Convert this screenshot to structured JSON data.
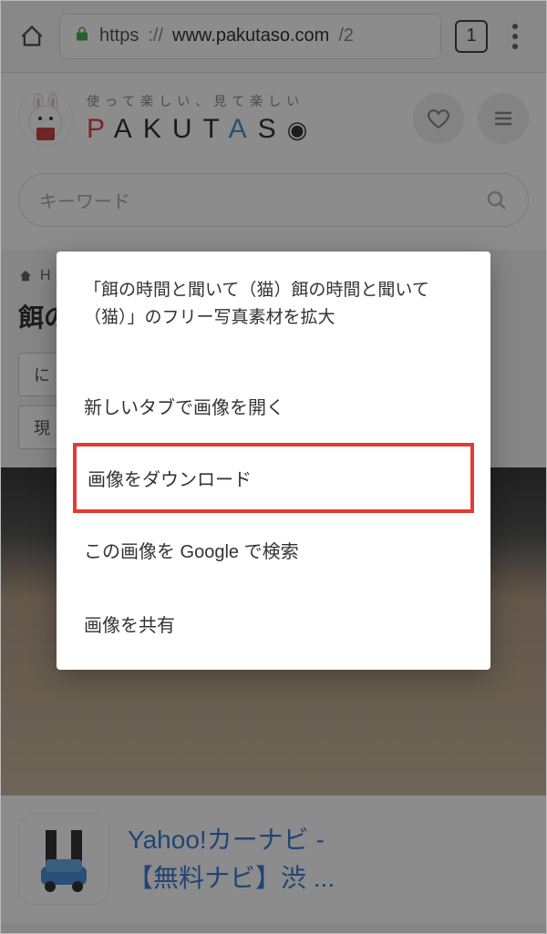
{
  "browser": {
    "url_scheme": "https",
    "url_prefix": "://",
    "url_host": "www.pakutaso.com",
    "url_tail": "/2",
    "tab_count": "1"
  },
  "header": {
    "tagline": "使って楽しい、見て楽しい",
    "brand_letters": [
      "P",
      "A",
      "K",
      "U",
      "T",
      "A",
      "S"
    ]
  },
  "search": {
    "placeholder": "キーワード"
  },
  "breadcrumb_home": "H",
  "page_title": "餌の",
  "tag1": "に",
  "tag2": "現",
  "ad": {
    "line1": "Yahoo!カーナビ - ",
    "line2": "【無料ナビ】渋 ..."
  },
  "context_menu": {
    "title": "「餌の時間と聞いて（猫）餌の時間と聞いて（猫）」のフリー写真素材を拡大",
    "open_new_tab": "新しいタブで画像を開く",
    "download_image": "画像をダウンロード",
    "search_google": "この画像を Google で検索",
    "share_image": "画像を共有"
  }
}
